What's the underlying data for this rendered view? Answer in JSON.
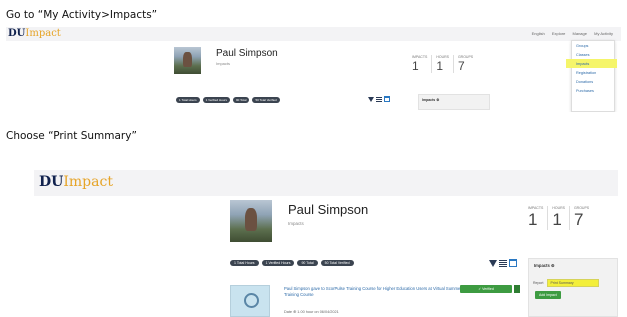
{
  "instructions": {
    "step1": "Go to “My Activity>Impacts”",
    "step2": "Choose “Print Summary”"
  },
  "app": {
    "logo_bold": "DU",
    "logo_light": "Impact",
    "brand_color": "#10214d",
    "accent_color": "#e6a428"
  },
  "topnav": {
    "items": [
      "English",
      "Explore",
      "Manage",
      "My Activity"
    ]
  },
  "activity_menu": {
    "items": [
      "Groups",
      "Classes",
      "Impacts",
      "Registration",
      "Donations",
      "Purchases"
    ],
    "active_index": 2,
    "highlight_color": "#f5f56a"
  },
  "profile": {
    "name": "Paul Simpson",
    "subtitle": "Impacts",
    "stats": [
      {
        "label": "IMPACTS",
        "value": "1"
      },
      {
        "label": "HOURS",
        "value": "1"
      },
      {
        "label": "GROUPS",
        "value": "7"
      }
    ]
  },
  "filter_pills": [
    "1 Total Hours",
    "1 Verified Hours",
    "90 Total",
    "50 Total Verified"
  ],
  "toolbar_icons": [
    "filter-icon",
    "list-view-icon",
    "calendar-icon"
  ],
  "impacts_panel": {
    "title": "Impacts ⚙",
    "report_label": "Report",
    "report_value": "Print Summary",
    "submit_label": "Add Impact"
  },
  "activity_item": {
    "title": "Paul Simpson gave to ScorPulse Training Course for Higher Education Users at Virtual Summer Training Course",
    "status_label": "✓ Verified",
    "meta": "Date ⊕ 1.00 hour on 06/04/2021"
  }
}
